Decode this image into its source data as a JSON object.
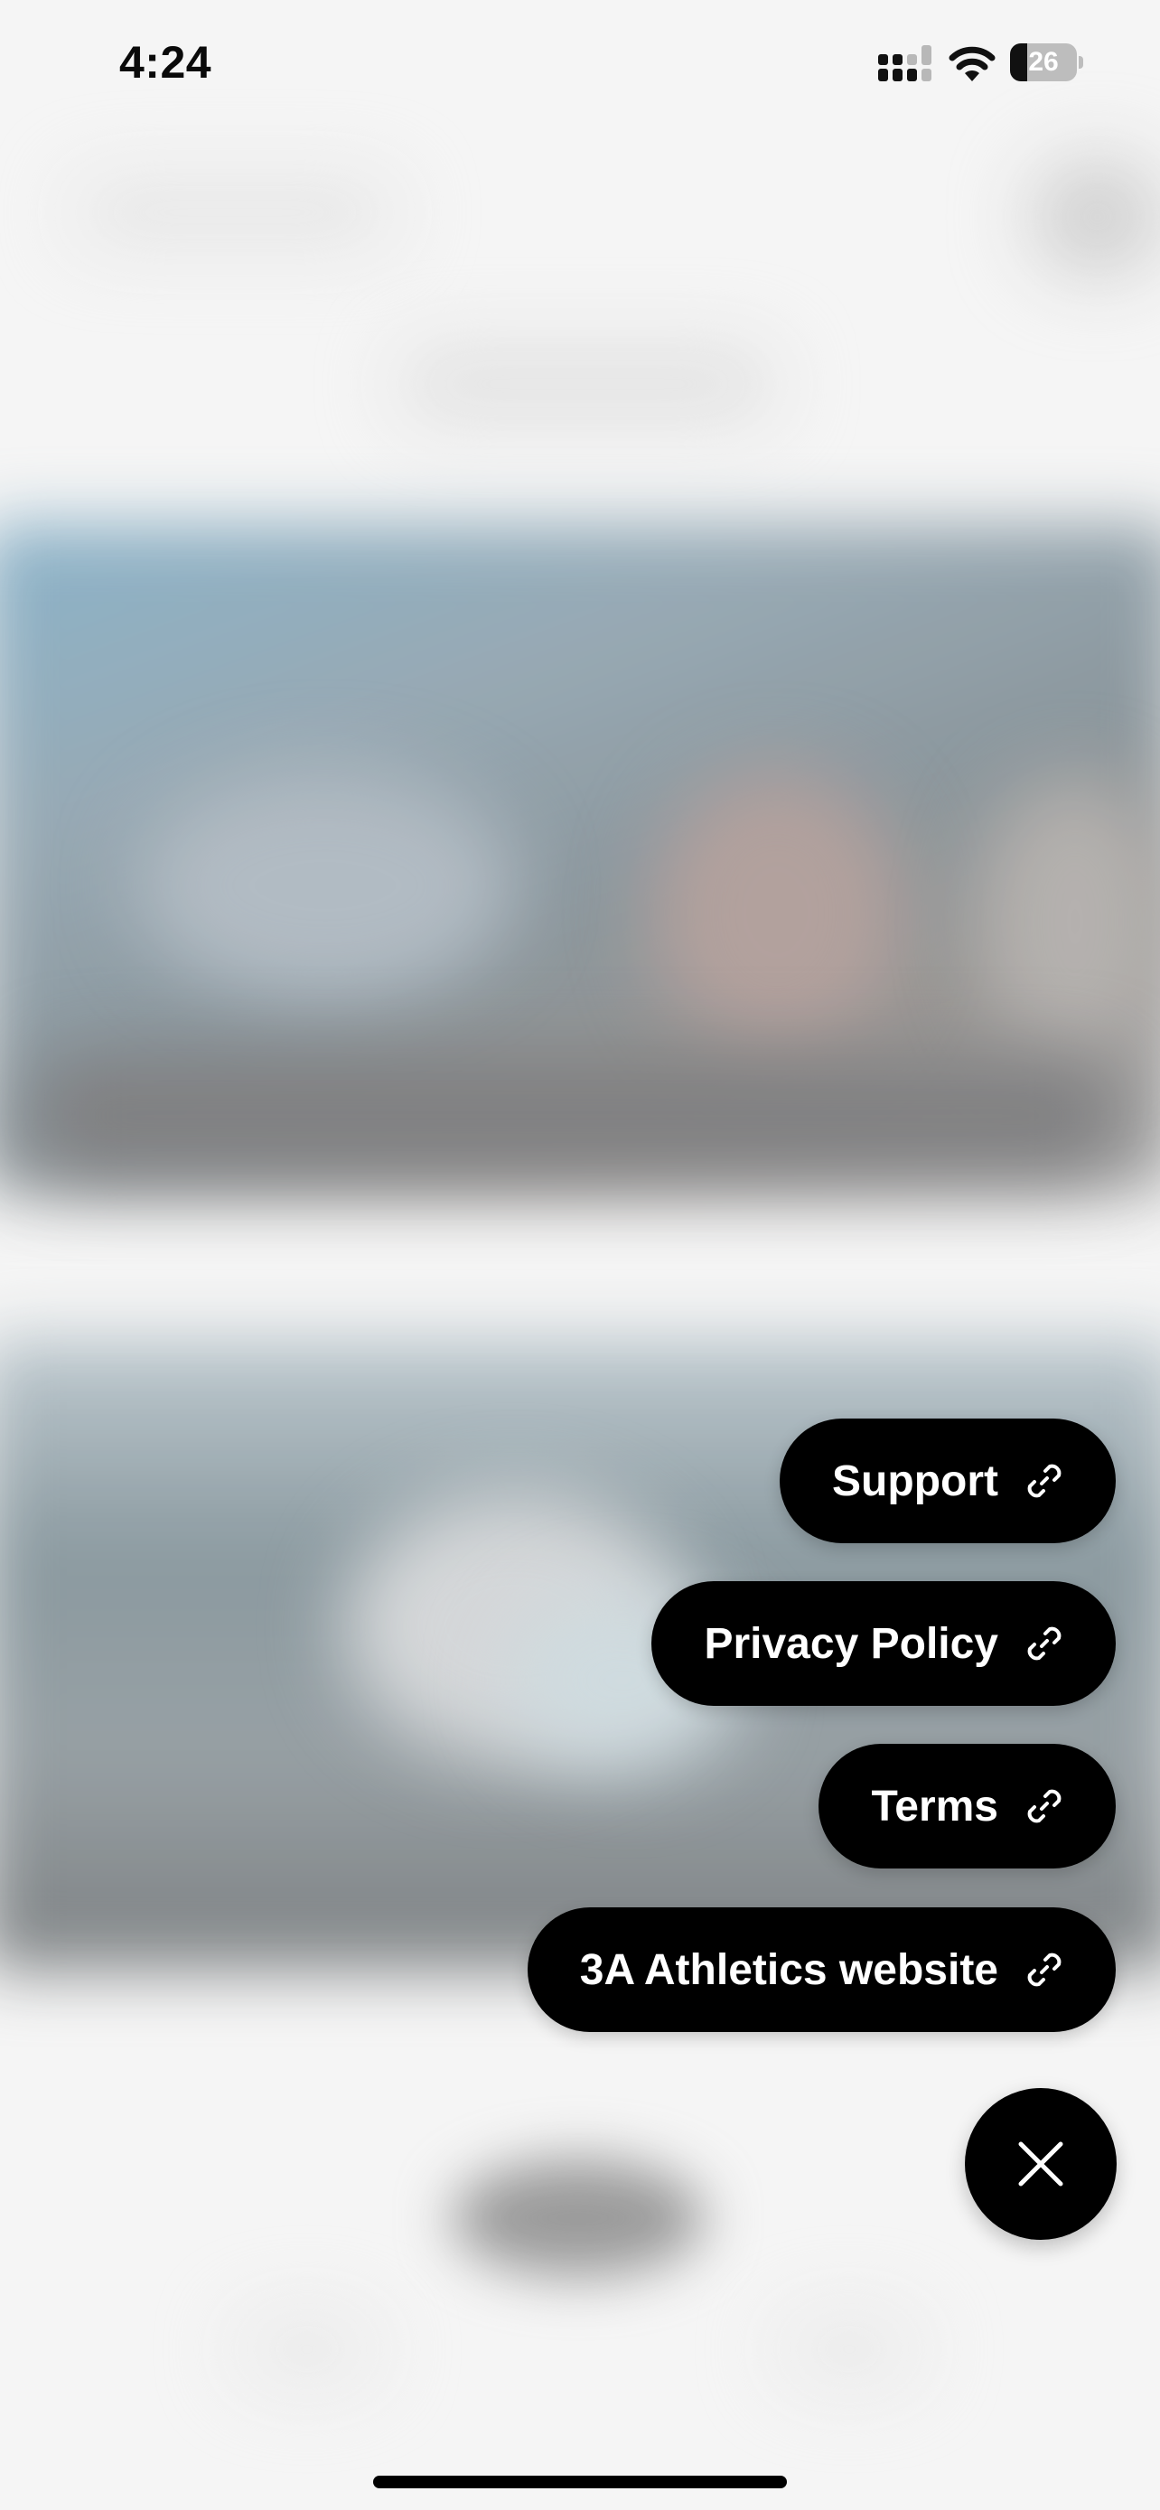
{
  "status_bar": {
    "time": "4:24",
    "battery_level": "26",
    "battery_fraction": 0.26,
    "signal_icon": "cellular-signal-icon",
    "wifi_icon": "wifi-icon"
  },
  "link_menu": {
    "items": [
      {
        "label": "Support",
        "icon": "link-icon"
      },
      {
        "label": "Privacy Policy",
        "icon": "link-icon"
      },
      {
        "label": "Terms",
        "icon": "link-icon"
      },
      {
        "label": "3A Athletics website",
        "icon": "link-icon"
      }
    ],
    "close_icon": "close-icon"
  },
  "colors": {
    "pill_background": "#000000",
    "pill_text": "#ffffff",
    "page_background": "#f4f4f4"
  }
}
